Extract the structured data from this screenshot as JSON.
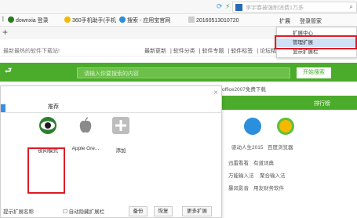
{
  "browser": {
    "address_search_text": "李宇春被强制消费1万多",
    "bookmarks": [
      "downxia 登录",
      "360手机助手(手机",
      "搜索 - 应用宝官网",
      "20160513010720"
    ],
    "new_tab": "+",
    "extension_bar": [
      "扩展",
      "登录管家"
    ]
  },
  "site": {
    "nav_left": "最新最热的软件下载站!",
    "nav_links": [
      "最新更新",
      "软件分类",
      "软件专题",
      "软件标签",
      "论坛精华"
    ],
    "search_placeholder": "请输入你要搜索的内容",
    "search_button": "开始搜索",
    "side_link": "office2007免费下载",
    "rank_header": "排行榜",
    "right_links": [
      "驱动人生2015",
      "百度浏览器",
      "迅雷看看",
      "有道词典",
      "万能输入法",
      "聚合输入法",
      "暴风影音",
      "用友财务软件"
    ]
  },
  "dialog": {
    "close": "×",
    "tab": "推荐",
    "extensions": [
      {
        "label": "夜间模式",
        "icon": "eye-icon"
      },
      {
        "label": "Apple Gre...",
        "icon": "apple-icon"
      },
      {
        "label": "添加",
        "icon": "plus-icon"
      }
    ],
    "footer": {
      "left_text": "提示扩展名称",
      "checkbox": "自动隐藏扩展栏",
      "buttons": [
        "备份",
        "恢复",
        "更多扩展"
      ]
    }
  },
  "menu": {
    "items": [
      "扩展中心",
      "管理扩展",
      "显示扩展栏"
    ]
  },
  "colors": {
    "accent": "#4aac2a",
    "highlight": "#e01b24"
  }
}
